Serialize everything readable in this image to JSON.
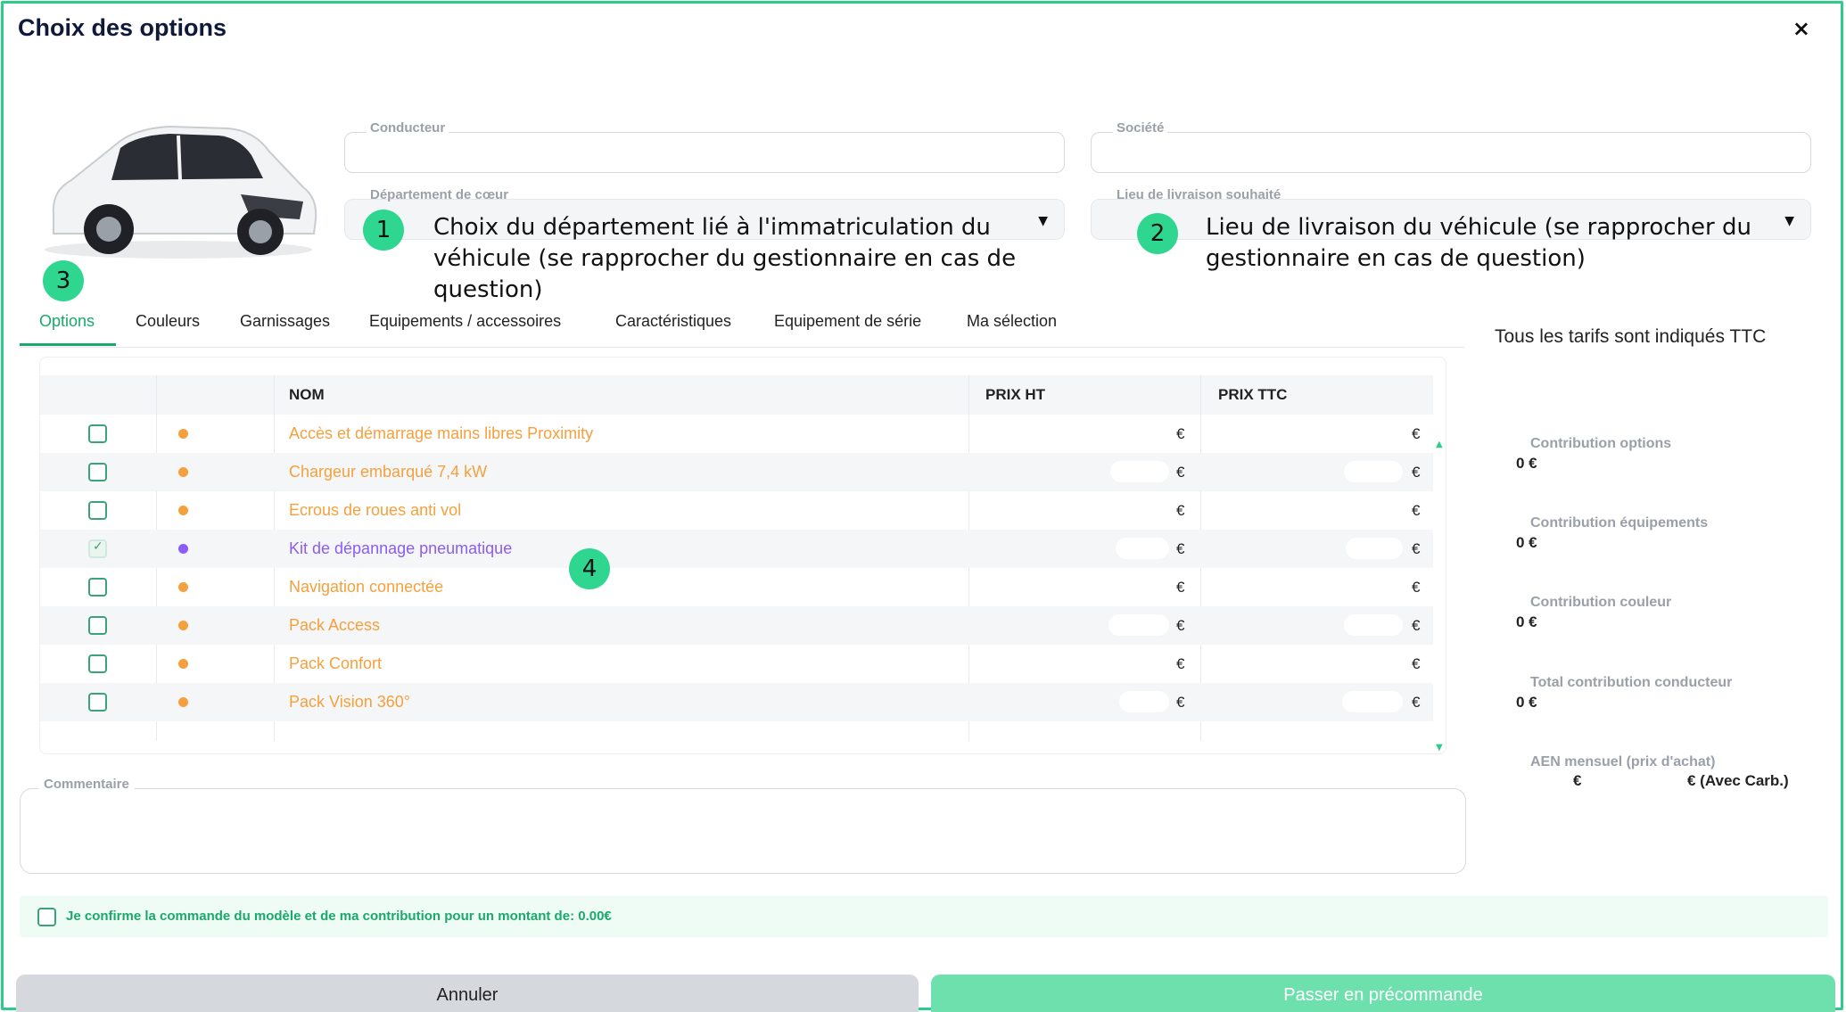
{
  "window": {
    "title": "Choix des options",
    "close_label": "×"
  },
  "fields": {
    "conducteur": {
      "label": "Conducteur",
      "value": ""
    },
    "societe": {
      "label": "Société",
      "value": ""
    },
    "departement": {
      "label": "Département de cœur",
      "value": ""
    },
    "lieu": {
      "label": "Lieu de livraison souhaité",
      "value": ""
    }
  },
  "annotations": {
    "a1": {
      "number": "1",
      "text": "Choix du département lié à l'immatriculation du véhicule (se rapprocher du gestionnaire en cas de question)"
    },
    "a2": {
      "number": "2",
      "text": "Lieu de livraison du véhicule (se rapprocher du gestionnaire en cas de question)"
    },
    "a3": {
      "number": "3"
    },
    "a4": {
      "number": "4"
    }
  },
  "tabs": [
    "Options",
    "Couleurs",
    "Garnissages",
    "Equipements / accessoires",
    "Caractéristiques",
    "Equipement de série",
    "Ma sélection"
  ],
  "ttc_note": "Tous les tarifs sont indiqués TTC",
  "table": {
    "headers": {
      "nom": "NOM",
      "prix_ht": "PRIX HT",
      "prix_ttc": "PRIX TTC"
    },
    "currency": "€",
    "rows": [
      {
        "nom": "Accès et démarrage mains libres Proximity",
        "checked": false,
        "dot_color": "#f5a03c"
      },
      {
        "nom": "Chargeur embarqué 7,4 kW",
        "checked": false,
        "dot_color": "#f5a03c"
      },
      {
        "nom": "Ecrous de roues anti vol",
        "checked": false,
        "dot_color": "#f5a03c"
      },
      {
        "nom": "Kit de dépannage pneumatique",
        "checked": true,
        "dot_color": "#8b5cf6"
      },
      {
        "nom": "Navigation connectée",
        "checked": false,
        "dot_color": "#f5a03c"
      },
      {
        "nom": "Pack Access",
        "checked": false,
        "dot_color": "#f5a03c"
      },
      {
        "nom": "Pack Confort",
        "checked": false,
        "dot_color": "#f5a03c"
      },
      {
        "nom": "Pack Vision 360°",
        "checked": false,
        "dot_color": "#f5a03c"
      }
    ]
  },
  "contributions": {
    "options": {
      "label": "Contribution options",
      "value": "0 €"
    },
    "equipements": {
      "label": "Contribution équipements",
      "value": "0 €"
    },
    "couleur": {
      "label": "Contribution couleur",
      "value": "0 €"
    },
    "total": {
      "label": "Total contribution conducteur",
      "value": "0 €"
    },
    "aen": {
      "label": "AEN mensuel (prix d'achat)",
      "value_left": "€",
      "value_right": "€ (Avec Carb.)"
    }
  },
  "comment": {
    "label": "Commentaire",
    "value": ""
  },
  "confirm": {
    "text": "Je confirme la commande du modèle et de ma contribution pour un montant de: 0.00€",
    "checked": false
  },
  "buttons": {
    "cancel": "Annuler",
    "submit": "Passer en précommande"
  },
  "colors": {
    "accent": "#2ecc8a",
    "option_orange": "#f5a03c",
    "option_purple": "#8b5cf6"
  }
}
